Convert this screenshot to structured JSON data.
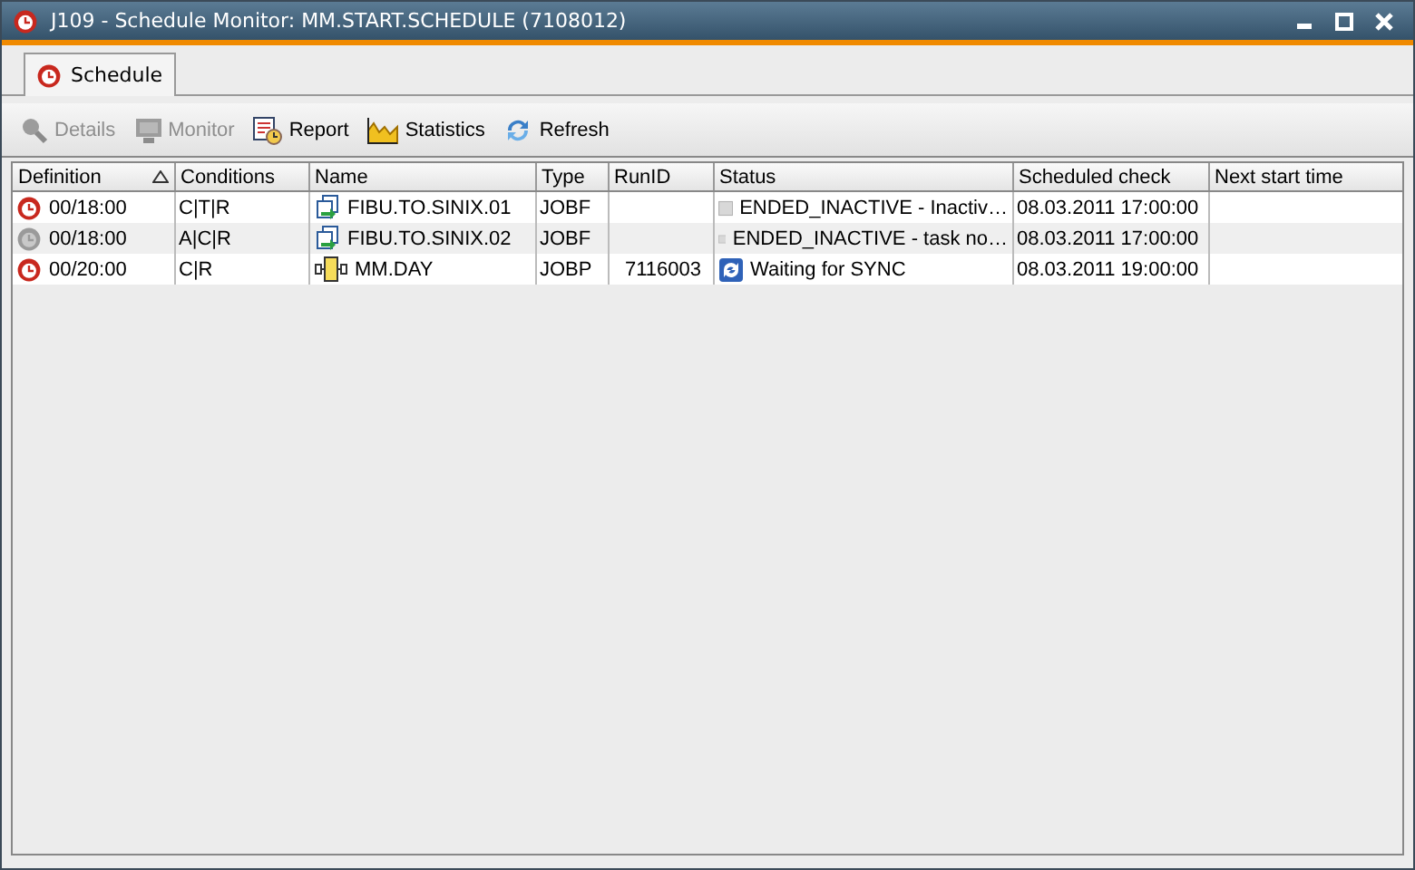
{
  "window": {
    "title": "J109 - Schedule Monitor: MM.START.SCHEDULE (7108012)"
  },
  "tabs": [
    {
      "label": "Schedule",
      "selected": true
    }
  ],
  "toolbar": [
    {
      "label": "Details",
      "kind": "details",
      "disabled": true
    },
    {
      "label": "Monitor",
      "kind": "monitor",
      "disabled": true
    },
    {
      "label": "Report",
      "kind": "report",
      "disabled": false
    },
    {
      "label": "Statistics",
      "kind": "statistics",
      "disabled": false
    },
    {
      "label": "Refresh",
      "kind": "refresh",
      "disabled": false
    }
  ],
  "table": {
    "columns": [
      {
        "label": "Definition",
        "sorted": true
      },
      {
        "label": "Conditions",
        "sorted": false
      },
      {
        "label": "Name",
        "sorted": false
      },
      {
        "label": "Type",
        "sorted": false
      },
      {
        "label": "RunID",
        "sorted": false
      },
      {
        "label": "Status",
        "sorted": false
      },
      {
        "label": "Scheduled check",
        "sorted": false
      },
      {
        "label": "Next start time",
        "sorted": false
      }
    ],
    "rows": [
      {
        "definition": "00/18:00",
        "active": true,
        "conditions": "C|T|R",
        "name": {
          "text": "FIBU.TO.SINIX.01",
          "kind": "jobf"
        },
        "type": "JOBF",
        "status": {
          "text": "ENDED_INACTIVE - Inactiv…",
          "kind": "none"
        },
        "scheduled_check": "08.03.2011 17:00:00"
      },
      {
        "definition": "00/18:00",
        "active": false,
        "conditions": "A|C|R",
        "name": {
          "text": "FIBU.TO.SINIX.02",
          "kind": "jobf"
        },
        "type": "JOBF",
        "status": {
          "text": "ENDED_INACTIVE - task no…",
          "kind": "none"
        },
        "scheduled_check": "08.03.2011 17:00:00"
      },
      {
        "definition": "00/20:00",
        "active": true,
        "conditions": "C|R",
        "name": {
          "text": "MM.DAY",
          "kind": "jobp"
        },
        "type": "JOBP",
        "run_id": "7116003",
        "status": {
          "text": "Waiting for SYNC",
          "kind": "sync"
        },
        "scheduled_check": "08.03.2011 19:00:00"
      }
    ]
  }
}
